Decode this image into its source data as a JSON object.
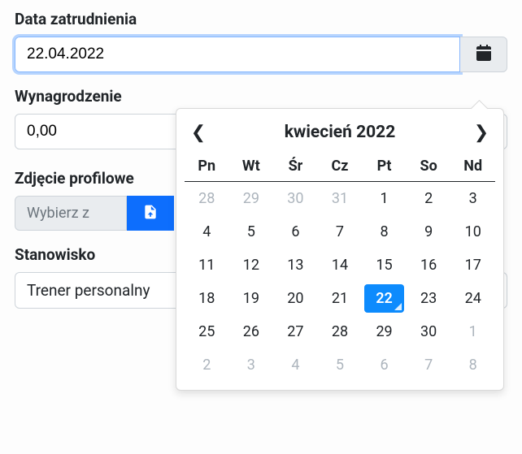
{
  "hire_date": {
    "label": "Data zatrudnienia",
    "value": "22.04.2022"
  },
  "salary": {
    "label": "Wynagrodzenie",
    "value": "0,00"
  },
  "profile_photo": {
    "label": "Zdjęcie profilowe",
    "button_text": "Wybierz z"
  },
  "position": {
    "label": "Stanowisko",
    "value": "Trener personalny"
  },
  "datepicker": {
    "title": "kwiecień 2022",
    "dow": [
      "Pn",
      "Wt",
      "Śr",
      "Cz",
      "Pt",
      "So",
      "Nd"
    ],
    "days": [
      {
        "n": 28,
        "muted": true
      },
      {
        "n": 29,
        "muted": true
      },
      {
        "n": 30,
        "muted": true
      },
      {
        "n": 31,
        "muted": true
      },
      {
        "n": 1
      },
      {
        "n": 2
      },
      {
        "n": 3
      },
      {
        "n": 4
      },
      {
        "n": 5
      },
      {
        "n": 6
      },
      {
        "n": 7
      },
      {
        "n": 8
      },
      {
        "n": 9
      },
      {
        "n": 10
      },
      {
        "n": 11
      },
      {
        "n": 12
      },
      {
        "n": 13
      },
      {
        "n": 14
      },
      {
        "n": 15
      },
      {
        "n": 16
      },
      {
        "n": 17
      },
      {
        "n": 18
      },
      {
        "n": 19
      },
      {
        "n": 20
      },
      {
        "n": 21
      },
      {
        "n": 22,
        "selected": true,
        "today": true
      },
      {
        "n": 23
      },
      {
        "n": 24
      },
      {
        "n": 25
      },
      {
        "n": 26
      },
      {
        "n": 27
      },
      {
        "n": 28
      },
      {
        "n": 29
      },
      {
        "n": 30
      },
      {
        "n": 1,
        "muted": true
      },
      {
        "n": 2,
        "muted": true
      },
      {
        "n": 3,
        "muted": true
      },
      {
        "n": 4,
        "muted": true
      },
      {
        "n": 5,
        "muted": true
      },
      {
        "n": 6,
        "muted": true
      },
      {
        "n": 7,
        "muted": true
      },
      {
        "n": 8,
        "muted": true
      }
    ]
  }
}
